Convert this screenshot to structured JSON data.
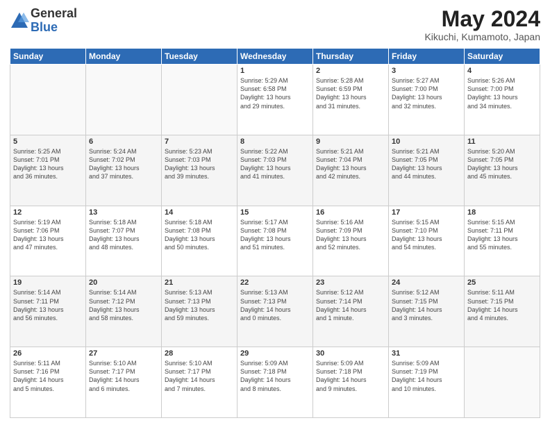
{
  "logo": {
    "general": "General",
    "blue": "Blue"
  },
  "header": {
    "month_year": "May 2024",
    "location": "Kikuchi, Kumamoto, Japan"
  },
  "weekdays": [
    "Sunday",
    "Monday",
    "Tuesday",
    "Wednesday",
    "Thursday",
    "Friday",
    "Saturday"
  ],
  "weeks": [
    [
      {
        "day": "",
        "info": ""
      },
      {
        "day": "",
        "info": ""
      },
      {
        "day": "",
        "info": ""
      },
      {
        "day": "1",
        "info": "Sunrise: 5:29 AM\nSunset: 6:58 PM\nDaylight: 13 hours\nand 29 minutes."
      },
      {
        "day": "2",
        "info": "Sunrise: 5:28 AM\nSunset: 6:59 PM\nDaylight: 13 hours\nand 31 minutes."
      },
      {
        "day": "3",
        "info": "Sunrise: 5:27 AM\nSunset: 7:00 PM\nDaylight: 13 hours\nand 32 minutes."
      },
      {
        "day": "4",
        "info": "Sunrise: 5:26 AM\nSunset: 7:00 PM\nDaylight: 13 hours\nand 34 minutes."
      }
    ],
    [
      {
        "day": "5",
        "info": "Sunrise: 5:25 AM\nSunset: 7:01 PM\nDaylight: 13 hours\nand 36 minutes."
      },
      {
        "day": "6",
        "info": "Sunrise: 5:24 AM\nSunset: 7:02 PM\nDaylight: 13 hours\nand 37 minutes."
      },
      {
        "day": "7",
        "info": "Sunrise: 5:23 AM\nSunset: 7:03 PM\nDaylight: 13 hours\nand 39 minutes."
      },
      {
        "day": "8",
        "info": "Sunrise: 5:22 AM\nSunset: 7:03 PM\nDaylight: 13 hours\nand 41 minutes."
      },
      {
        "day": "9",
        "info": "Sunrise: 5:21 AM\nSunset: 7:04 PM\nDaylight: 13 hours\nand 42 minutes."
      },
      {
        "day": "10",
        "info": "Sunrise: 5:21 AM\nSunset: 7:05 PM\nDaylight: 13 hours\nand 44 minutes."
      },
      {
        "day": "11",
        "info": "Sunrise: 5:20 AM\nSunset: 7:05 PM\nDaylight: 13 hours\nand 45 minutes."
      }
    ],
    [
      {
        "day": "12",
        "info": "Sunrise: 5:19 AM\nSunset: 7:06 PM\nDaylight: 13 hours\nand 47 minutes."
      },
      {
        "day": "13",
        "info": "Sunrise: 5:18 AM\nSunset: 7:07 PM\nDaylight: 13 hours\nand 48 minutes."
      },
      {
        "day": "14",
        "info": "Sunrise: 5:18 AM\nSunset: 7:08 PM\nDaylight: 13 hours\nand 50 minutes."
      },
      {
        "day": "15",
        "info": "Sunrise: 5:17 AM\nSunset: 7:08 PM\nDaylight: 13 hours\nand 51 minutes."
      },
      {
        "day": "16",
        "info": "Sunrise: 5:16 AM\nSunset: 7:09 PM\nDaylight: 13 hours\nand 52 minutes."
      },
      {
        "day": "17",
        "info": "Sunrise: 5:15 AM\nSunset: 7:10 PM\nDaylight: 13 hours\nand 54 minutes."
      },
      {
        "day": "18",
        "info": "Sunrise: 5:15 AM\nSunset: 7:11 PM\nDaylight: 13 hours\nand 55 minutes."
      }
    ],
    [
      {
        "day": "19",
        "info": "Sunrise: 5:14 AM\nSunset: 7:11 PM\nDaylight: 13 hours\nand 56 minutes."
      },
      {
        "day": "20",
        "info": "Sunrise: 5:14 AM\nSunset: 7:12 PM\nDaylight: 13 hours\nand 58 minutes."
      },
      {
        "day": "21",
        "info": "Sunrise: 5:13 AM\nSunset: 7:13 PM\nDaylight: 13 hours\nand 59 minutes."
      },
      {
        "day": "22",
        "info": "Sunrise: 5:13 AM\nSunset: 7:13 PM\nDaylight: 14 hours\nand 0 minutes."
      },
      {
        "day": "23",
        "info": "Sunrise: 5:12 AM\nSunset: 7:14 PM\nDaylight: 14 hours\nand 1 minute."
      },
      {
        "day": "24",
        "info": "Sunrise: 5:12 AM\nSunset: 7:15 PM\nDaylight: 14 hours\nand 3 minutes."
      },
      {
        "day": "25",
        "info": "Sunrise: 5:11 AM\nSunset: 7:15 PM\nDaylight: 14 hours\nand 4 minutes."
      }
    ],
    [
      {
        "day": "26",
        "info": "Sunrise: 5:11 AM\nSunset: 7:16 PM\nDaylight: 14 hours\nand 5 minutes."
      },
      {
        "day": "27",
        "info": "Sunrise: 5:10 AM\nSunset: 7:17 PM\nDaylight: 14 hours\nand 6 minutes."
      },
      {
        "day": "28",
        "info": "Sunrise: 5:10 AM\nSunset: 7:17 PM\nDaylight: 14 hours\nand 7 minutes."
      },
      {
        "day": "29",
        "info": "Sunrise: 5:09 AM\nSunset: 7:18 PM\nDaylight: 14 hours\nand 8 minutes."
      },
      {
        "day": "30",
        "info": "Sunrise: 5:09 AM\nSunset: 7:18 PM\nDaylight: 14 hours\nand 9 minutes."
      },
      {
        "day": "31",
        "info": "Sunrise: 5:09 AM\nSunset: 7:19 PM\nDaylight: 14 hours\nand 10 minutes."
      },
      {
        "day": "",
        "info": ""
      }
    ]
  ]
}
